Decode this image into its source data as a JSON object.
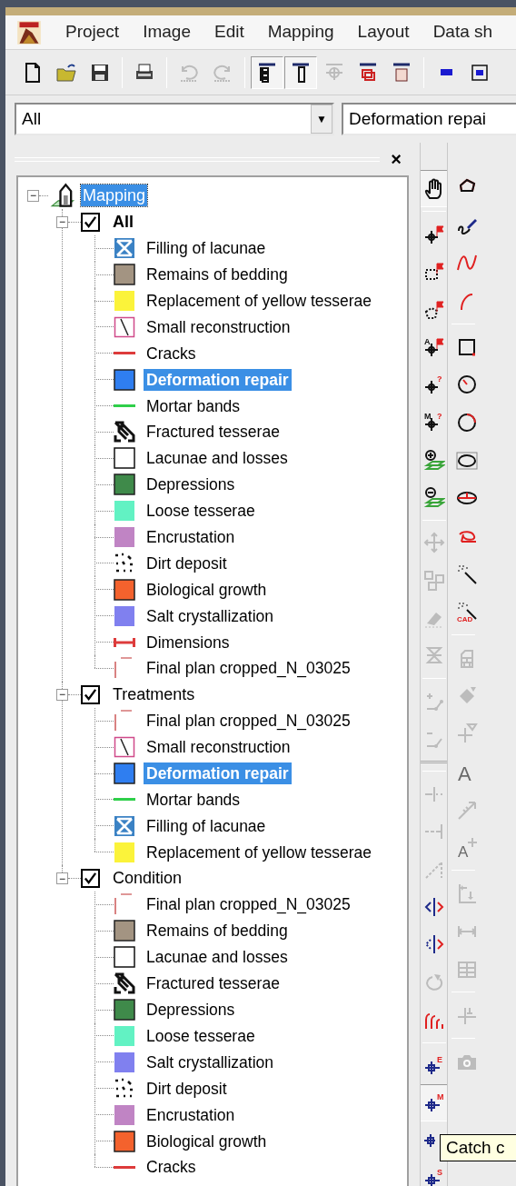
{
  "menu": [
    "Project",
    "Image",
    "Edit",
    "Mapping",
    "Layout",
    "Data sh"
  ],
  "toolbar": [
    {
      "kind": "new-page",
      "disabled": false,
      "pressed": false
    },
    {
      "kind": "folder",
      "disabled": false,
      "pressed": false
    },
    {
      "kind": "floppy",
      "disabled": false,
      "pressed": false
    },
    {
      "kind": "separator"
    },
    {
      "kind": "printer",
      "disabled": false,
      "pressed": false
    },
    {
      "kind": "separator"
    },
    {
      "kind": "undo",
      "disabled": true,
      "pressed": false
    },
    {
      "kind": "redo",
      "disabled": true,
      "pressed": false
    },
    {
      "kind": "separator"
    },
    {
      "kind": "tree-panel",
      "disabled": false,
      "pressed": true
    },
    {
      "kind": "side-panel",
      "disabled": false,
      "pressed": true
    },
    {
      "kind": "crosshair-panel",
      "disabled": true,
      "pressed": false
    },
    {
      "kind": "layers-panel",
      "disabled": false,
      "pressed": false
    },
    {
      "kind": "grid-panel",
      "disabled": false,
      "pressed": false
    },
    {
      "kind": "separator"
    },
    {
      "kind": "blue-bar",
      "disabled": false,
      "pressed": false
    },
    {
      "kind": "frame",
      "disabled": false,
      "pressed": false
    }
  ],
  "combos": [
    {
      "value": "All",
      "arrow": "▼"
    },
    {
      "value": "Deformation repai"
    }
  ],
  "panel": {
    "close": "×"
  },
  "tree": {
    "label": "Mapping",
    "selected": true,
    "expanded": true,
    "toggle": "−",
    "children": [
      {
        "label": "All",
        "checked": true,
        "active": true,
        "expanded": true,
        "toggle": "−",
        "children": [
          {
            "label": "Filling of lacunae",
            "kind": "x-box",
            "color": "#3b82c4",
            "active": false
          },
          {
            "label": "Remains of bedding",
            "kind": "fill",
            "color": "#a39482",
            "active": false
          },
          {
            "label": "Replacement of yellow tesserae",
            "kind": "fill",
            "color": "#fbf33a",
            "active": false
          },
          {
            "label": "Small reconstruction",
            "kind": "diagonal",
            "color": "#d04a8a",
            "active": false
          },
          {
            "label": "Cracks",
            "kind": "line",
            "color": "#dd3b3b",
            "active": false
          },
          {
            "label": "Deformation repair",
            "kind": "fill",
            "color": "#2f7ef0",
            "active": true
          },
          {
            "label": "Mortar bands",
            "kind": "line",
            "color": "#2fcf4a",
            "active": false
          },
          {
            "label": "Fractured tesserae",
            "kind": "fractured",
            "active": false
          },
          {
            "label": "Lacunae and losses",
            "kind": "empty",
            "active": false
          },
          {
            "label": "Depressions",
            "kind": "fill",
            "color": "#3f8a4a",
            "active": false
          },
          {
            "label": "Loose tesserae",
            "kind": "fill",
            "color": "#62f2c3",
            "active": false
          },
          {
            "label": "Encrustation",
            "kind": "fill",
            "color": "#c084c4",
            "active": false
          },
          {
            "label": "Dirt deposit",
            "kind": "dots",
            "active": false
          },
          {
            "label": "Biological growth",
            "kind": "fill",
            "color": "#f4622d",
            "active": false
          },
          {
            "label": "Salt crystallization",
            "kind": "fill",
            "color": "#8080ef",
            "active": false
          },
          {
            "label": "Dimensions",
            "kind": "dimension",
            "color": "#dd3b3b",
            "active": false
          },
          {
            "label": "Final plan cropped_N_03025",
            "kind": "image",
            "active": false
          }
        ]
      },
      {
        "label": "Treatments",
        "checked": true,
        "active": false,
        "expanded": true,
        "toggle": "−",
        "children": [
          {
            "label": "Final plan cropped_N_03025",
            "kind": "image",
            "active": false
          },
          {
            "label": "Small reconstruction",
            "kind": "diagonal",
            "color": "#d04a8a",
            "active": false
          },
          {
            "label": "Deformation repair",
            "kind": "fill",
            "color": "#2f7ef0",
            "active": true
          },
          {
            "label": "Mortar bands",
            "kind": "line",
            "color": "#2fcf4a",
            "active": false
          },
          {
            "label": "Filling of lacunae",
            "kind": "x-box",
            "color": "#3b82c4",
            "active": false
          },
          {
            "label": "Replacement of yellow tesserae",
            "kind": "fill",
            "color": "#fbf33a",
            "active": false
          }
        ]
      },
      {
        "label": "Condition",
        "checked": true,
        "active": false,
        "expanded": true,
        "toggle": "−",
        "children": [
          {
            "label": "Final plan cropped_N_03025",
            "kind": "image",
            "active": false
          },
          {
            "label": "Remains of bedding",
            "kind": "fill",
            "color": "#a39482",
            "active": false
          },
          {
            "label": "Lacunae and losses",
            "kind": "empty",
            "active": false
          },
          {
            "label": "Fractured tesserae",
            "kind": "fractured",
            "active": false
          },
          {
            "label": "Depressions",
            "kind": "fill",
            "color": "#3f8a4a",
            "active": false
          },
          {
            "label": "Loose tesserae",
            "kind": "fill",
            "color": "#62f2c3",
            "active": false
          },
          {
            "label": "Salt crystallization",
            "kind": "fill",
            "color": "#8080ef",
            "active": false
          },
          {
            "label": "Dirt deposit",
            "kind": "dots",
            "active": false
          },
          {
            "label": "Encrustation",
            "kind": "fill",
            "color": "#c084c4",
            "active": false
          },
          {
            "label": "Biological growth",
            "kind": "fill",
            "color": "#f4622d",
            "active": false
          },
          {
            "label": "Cracks",
            "kind": "line",
            "color": "#dd3b3b",
            "active": false
          }
        ]
      }
    ]
  },
  "tools_left": [
    {
      "kind": "hand",
      "disabled": false,
      "pressed": true
    },
    {
      "kind": "separator"
    },
    {
      "kind": "crosshair-flag",
      "disabled": false,
      "pressed": false
    },
    {
      "kind": "dotted-rectangle-flag",
      "disabled": false,
      "pressed": false
    },
    {
      "kind": "dotted-polygon-flag",
      "disabled": false,
      "pressed": false
    },
    {
      "kind": "letter-crosshair-flag",
      "disabled": false,
      "pressed": false,
      "prefix": "A"
    },
    {
      "kind": "crosshair-question",
      "disabled": false,
      "pressed": false,
      "letter": "?"
    },
    {
      "kind": "letter-crosshair-question",
      "disabled": false,
      "pressed": false,
      "prefix": "M",
      "letter": "?"
    },
    {
      "kind": "plus-layers",
      "disabled": false,
      "pressed": false
    },
    {
      "kind": "minus-layers",
      "disabled": false,
      "pressed": false
    },
    {
      "kind": "separator"
    },
    {
      "kind": "move-arrows",
      "disabled": true,
      "pressed": false
    },
    {
      "kind": "squares",
      "disabled": true,
      "pressed": false
    },
    {
      "kind": "eraser",
      "disabled": true,
      "pressed": false
    },
    {
      "kind": "flip",
      "disabled": true,
      "pressed": false
    },
    {
      "kind": "separator"
    },
    {
      "kind": "plus-node",
      "disabled": true,
      "pressed": false
    },
    {
      "kind": "minus-node",
      "disabled": true,
      "pressed": false
    },
    {
      "kind": "divider"
    },
    {
      "kind": "separator"
    },
    {
      "kind": "split-line",
      "disabled": true,
      "pressed": false
    },
    {
      "kind": "end-line",
      "disabled": true,
      "pressed": false
    },
    {
      "kind": "diagonal-line",
      "disabled": true,
      "pressed": false
    },
    {
      "kind": "mirror",
      "disabled": false,
      "pressed": false
    },
    {
      "kind": "dotted-mirror",
      "disabled": false,
      "pressed": false
    },
    {
      "kind": "rotate",
      "disabled": true,
      "pressed": false
    },
    {
      "kind": "arcs",
      "disabled": false,
      "pressed": false
    },
    {
      "kind": "separator"
    },
    {
      "kind": "crosshair-letter",
      "disabled": false,
      "pressed": false,
      "letter": "E"
    },
    {
      "kind": "crosshair-letter",
      "disabled": false,
      "pressed": true,
      "letter": "M"
    },
    {
      "kind": "crosshair-letter",
      "disabled": false,
      "pressed": false
    },
    {
      "kind": "crosshair-letter",
      "disabled": false,
      "pressed": false,
      "letter": "S"
    }
  ],
  "tools_right": [
    {
      "kind": "polygon",
      "disabled": false,
      "pressed": false
    },
    {
      "kind": "pen",
      "disabled": false,
      "pressed": false
    },
    {
      "kind": "wave",
      "disabled": false,
      "pressed": false
    },
    {
      "kind": "arc",
      "disabled": false,
      "pressed": false
    },
    {
      "kind": "separator"
    },
    {
      "kind": "square",
      "disabled": false,
      "pressed": false
    },
    {
      "kind": "circle-radius",
      "disabled": false,
      "pressed": false
    },
    {
      "kind": "circle",
      "disabled": false,
      "pressed": false
    },
    {
      "kind": "ellipse-box",
      "disabled": false,
      "pressed": false
    },
    {
      "kind": "ellipse",
      "disabled": false,
      "pressed": false
    },
    {
      "kind": "lasso",
      "disabled": false,
      "pressed": false
    },
    {
      "kind": "wand",
      "disabled": false,
      "pressed": false
    },
    {
      "kind": "wand-letters",
      "disabled": false,
      "pressed": false,
      "letter": "CAD"
    },
    {
      "kind": "separator"
    },
    {
      "kind": "bricks",
      "disabled": true,
      "pressed": false
    },
    {
      "kind": "bucket",
      "disabled": true,
      "pressed": false
    },
    {
      "kind": "cross-triangle",
      "disabled": true,
      "pressed": false
    },
    {
      "kind": "letter",
      "disabled": true,
      "pressed": false,
      "letter": "A"
    },
    {
      "kind": "arrow",
      "disabled": true,
      "pressed": false
    },
    {
      "kind": "letter-move",
      "disabled": true,
      "pressed": false,
      "letter": "A"
    },
    {
      "kind": "separator"
    },
    {
      "kind": "axes",
      "disabled": true,
      "pressed": false
    },
    {
      "kind": "dimension",
      "disabled": true,
      "pressed": false
    },
    {
      "kind": "table",
      "disabled": true,
      "pressed": false
    },
    {
      "kind": "separator"
    },
    {
      "kind": "cross",
      "disabled": true,
      "pressed": false
    },
    {
      "kind": "separator"
    },
    {
      "kind": "camera",
      "disabled": true,
      "pressed": false
    }
  ],
  "tooltip": {
    "text": "Catch c"
  }
}
